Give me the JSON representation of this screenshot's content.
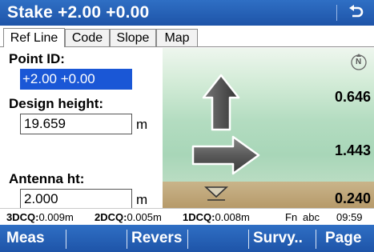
{
  "window": {
    "title": "Stake +2.00 +0.00"
  },
  "tabs": [
    {
      "label": "Ref Line",
      "active": true
    },
    {
      "label": "Code",
      "active": false
    },
    {
      "label": "Slope",
      "active": false
    },
    {
      "label": "Map",
      "active": false
    }
  ],
  "form": {
    "point_id_label": "Point ID:",
    "point_id_value": "+2.00 +0.00",
    "design_height_label": "Design height:",
    "design_height_value": "19.659",
    "design_height_unit": "m",
    "antenna_label": "Antenna ht:",
    "antenna_value": "2.000",
    "antenna_unit": "m"
  },
  "graphic": {
    "north_label": "N",
    "forward_value": "0.646",
    "right_value": "1.443",
    "cut_value": "0.240",
    "icons": [
      "north-compass-icon",
      "arrow-up-icon",
      "arrow-right-icon",
      "fill-triangle-icon"
    ],
    "colors": {
      "sky": "#b3dcc0",
      "ground": "#b69a6a",
      "arrow": "#5a5a5a"
    }
  },
  "status": {
    "q3_label": "3DCQ:",
    "q3_value": "0.009m",
    "q2_label": "2DCQ:",
    "q2_value": "0.005m",
    "q1_label": "1DCQ:",
    "q1_value": "0.008m",
    "fn": "Fn",
    "input_mode": "abc",
    "time": "09:59"
  },
  "softkeys": [
    "Meas",
    "Revers",
    "Survy..",
    "Page"
  ],
  "theme": {
    "accent": "#1e54a8",
    "selection": "#1a57d6"
  }
}
